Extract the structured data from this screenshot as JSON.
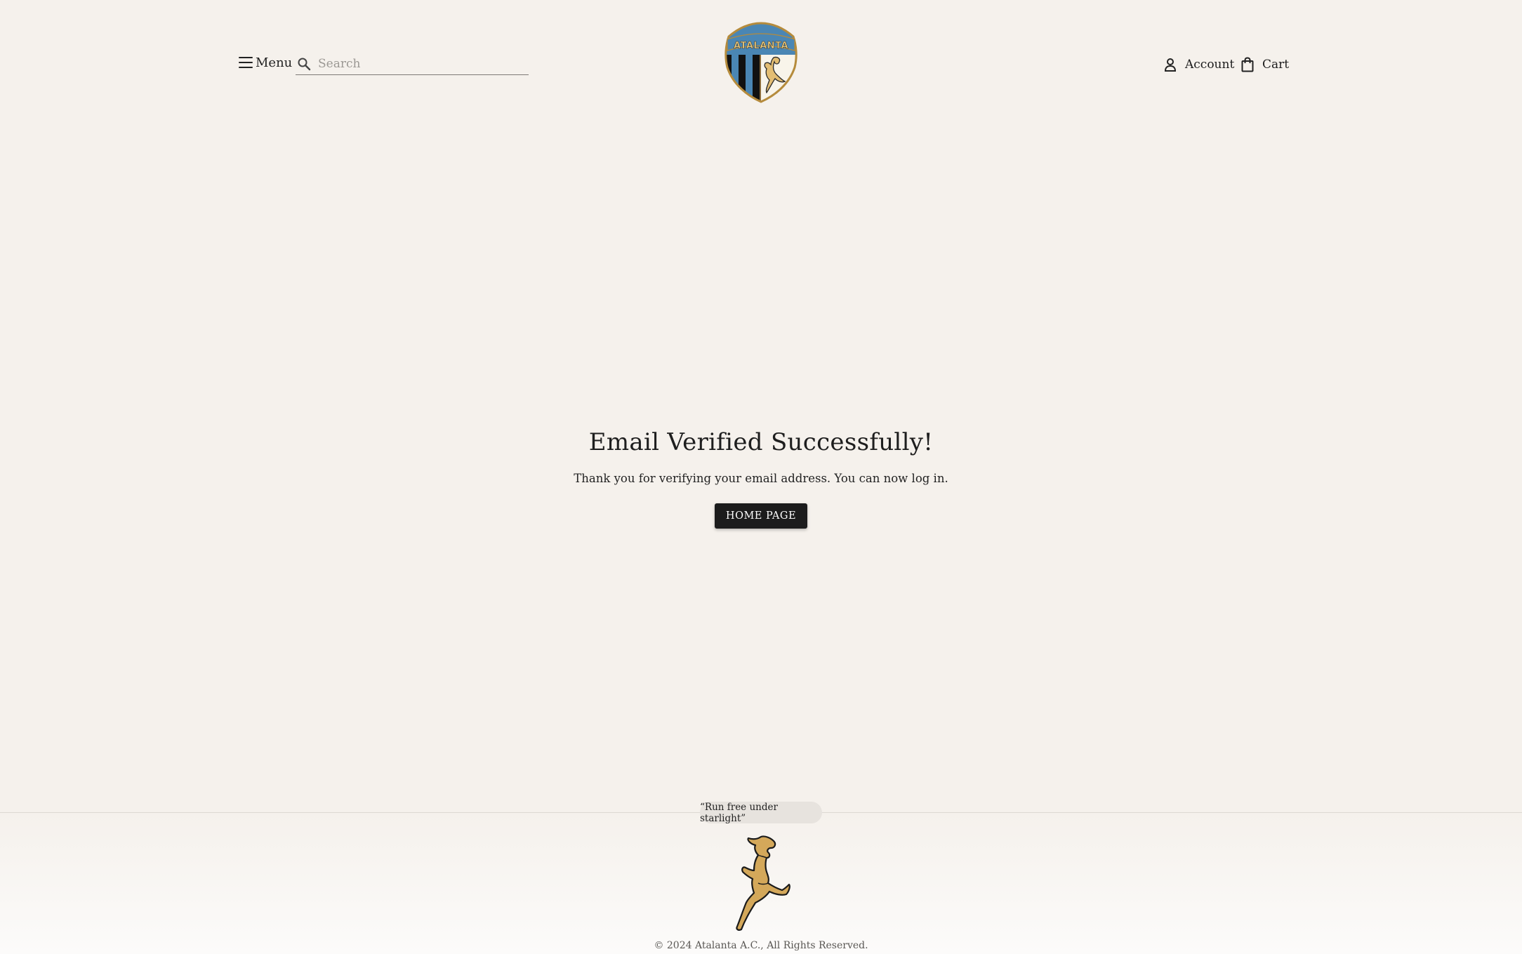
{
  "header": {
    "menu_label": "Menu",
    "search_placeholder": "Search",
    "search_value": "",
    "logo_text": "ATALANTA",
    "account_label": "Account",
    "cart_label": "Cart"
  },
  "main": {
    "title": "Email Verified Successfully!",
    "message": "Thank you for verifying your email address. You can now log in.",
    "home_button": "HOME PAGE"
  },
  "footer": {
    "tagline": "“Run free under starlight”",
    "copyright": "© 2024 Atalanta A.C., All Rights Reserved."
  },
  "colors": {
    "background": "#f5f1ec",
    "button": "#1c1c1c",
    "crest_blue": "#4a86b4",
    "crest_gold": "#d4a85a"
  },
  "icons": [
    "hamburger-icon",
    "search-icon",
    "account-icon",
    "cart-icon",
    "crest-logo",
    "runner-logo"
  ]
}
